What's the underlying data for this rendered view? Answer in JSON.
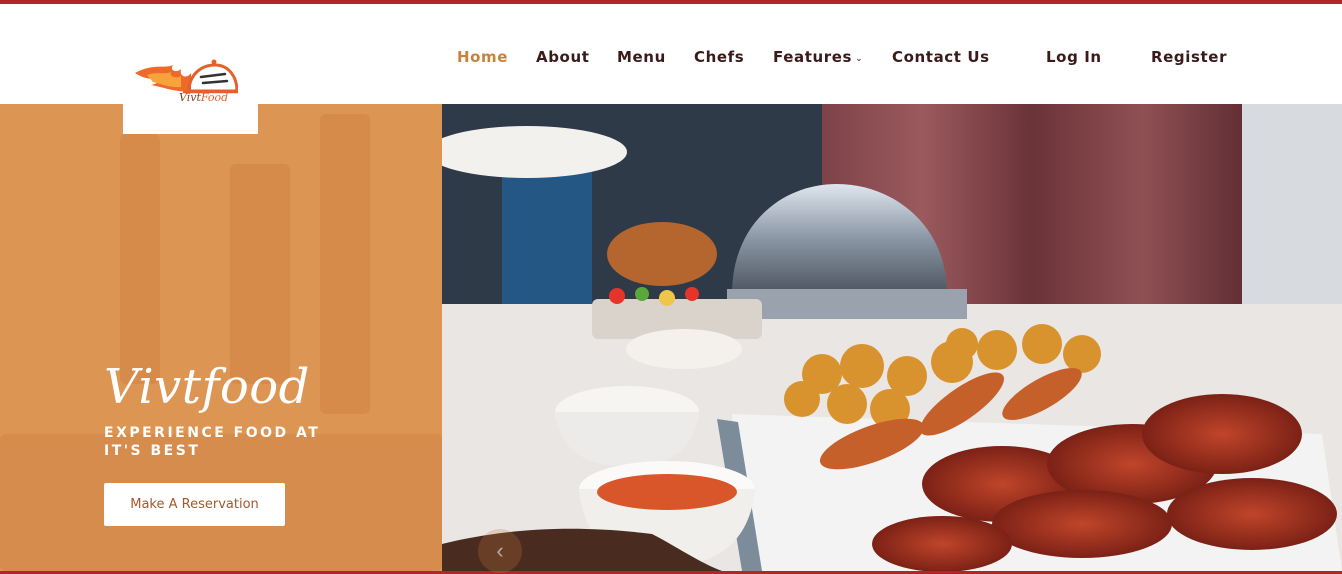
{
  "brand": {
    "logo_text_main": "Vivt",
    "logo_text_accent": "Food"
  },
  "nav": {
    "items": [
      {
        "label": "Home",
        "active": true
      },
      {
        "label": "About"
      },
      {
        "label": "Menu"
      },
      {
        "label": "Chefs"
      },
      {
        "label": "Features"
      },
      {
        "label": "Contact Us"
      },
      {
        "label": "Log In"
      },
      {
        "label": "Register"
      }
    ]
  },
  "hero": {
    "title": "Vivtfood",
    "subtitle": "EXPERIENCE FOOD AT IT'S BEST",
    "cta_label": "Make A Reservation",
    "prev_arrow": "‹"
  },
  "colors": {
    "accent": "#c9823e",
    "brand_red": "#b0272b",
    "panel": "#dd9553",
    "nav_text": "#3b1a1a"
  },
  "icons": [
    "flame-logo-icon",
    "cloche-icon",
    "chevron-down-icon",
    "chevron-left-icon"
  ]
}
